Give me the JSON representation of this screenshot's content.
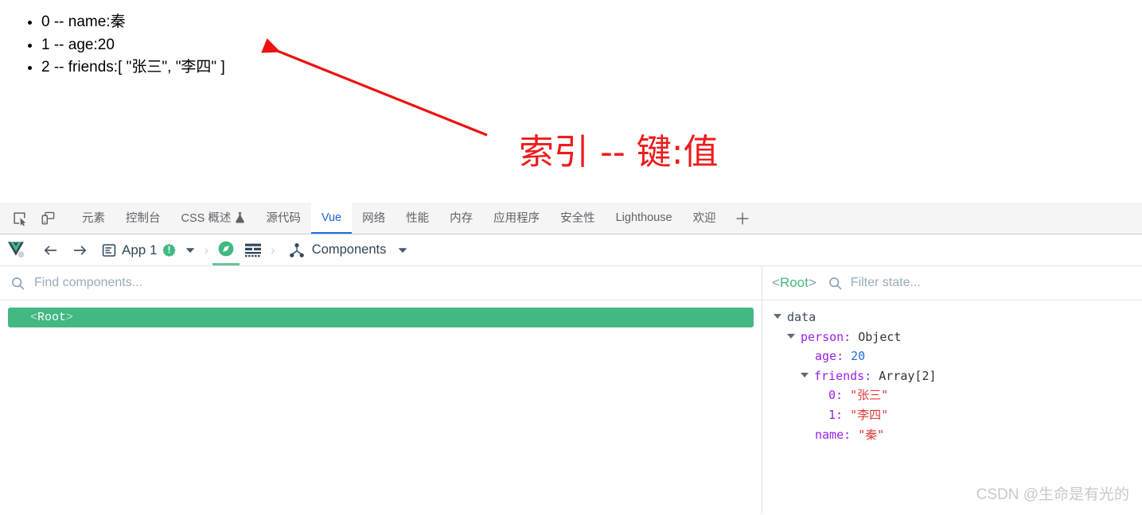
{
  "page": {
    "list_items": [
      "0 -- name:秦",
      "1 -- age:20",
      "2 -- friends:[ \"张三\", \"李四\" ]"
    ],
    "annotation": "索引 -- 键:值",
    "annotation_color": "#ee1c1c"
  },
  "devtools": {
    "left_icons": [
      {
        "name": "inspect-element-icon"
      },
      {
        "name": "device-toolbar-icon"
      }
    ],
    "tabs": [
      {
        "label": "元素",
        "active": false,
        "icon": null
      },
      {
        "label": "控制台",
        "active": false,
        "icon": null
      },
      {
        "label": "CSS 概述",
        "active": false,
        "icon": "flask-icon"
      },
      {
        "label": "源代码",
        "active": false,
        "icon": null
      },
      {
        "label": "Vue",
        "active": true,
        "icon": null
      },
      {
        "label": "网络",
        "active": false,
        "icon": null
      },
      {
        "label": "性能",
        "active": false,
        "icon": null
      },
      {
        "label": "内存",
        "active": false,
        "icon": null
      },
      {
        "label": "应用程序",
        "active": false,
        "icon": null
      },
      {
        "label": "安全性",
        "active": false,
        "icon": null
      },
      {
        "label": "Lighthouse",
        "active": false,
        "icon": null
      },
      {
        "label": "欢迎",
        "active": false,
        "icon": null
      }
    ],
    "add_tab_label": "+"
  },
  "vue_toolbar": {
    "logo": "vue-logo",
    "back_label": "←",
    "forward_label": "→",
    "app_label": "App 1",
    "app_badge": "!",
    "app_dropdown": "▾",
    "crumb_separator": "›",
    "inspector_tab_icon": "compass-icon",
    "timeline_tab_icon": "timeline-icon",
    "panel_label": "Components",
    "panel_dropdown": "▾",
    "accent_green": "#42b883"
  },
  "components_pane": {
    "search_placeholder": "Find components...",
    "search_value": "",
    "tree": [
      {
        "open_bracket": "<",
        "name": "Root",
        "close_bracket": ">",
        "selected": true
      }
    ]
  },
  "state_pane": {
    "root_open_bracket": "<",
    "root_name": "Root",
    "root_close_bracket": ">",
    "filter_placeholder": "Filter state...",
    "filter_value": "",
    "rows": [
      {
        "indent": 0,
        "caret": true,
        "key": "data",
        "key_style": "plain",
        "sep": "",
        "value": "",
        "value_style": "none"
      },
      {
        "indent": 1,
        "caret": true,
        "key": "person",
        "key_style": "prop",
        "sep": ": ",
        "value": "Object",
        "value_style": "type"
      },
      {
        "indent": 2,
        "caret": false,
        "key": "age",
        "key_style": "prop",
        "sep": ": ",
        "value": "20",
        "value_style": "num"
      },
      {
        "indent": 2,
        "caret": true,
        "key": "friends",
        "key_style": "prop",
        "sep": ": ",
        "value": "Array[2]",
        "value_style": "type"
      },
      {
        "indent": 3,
        "caret": false,
        "key": "0",
        "key_style": "prop",
        "sep": ": ",
        "value": "\"张三\"",
        "value_style": "str"
      },
      {
        "indent": 3,
        "caret": false,
        "key": "1",
        "key_style": "prop",
        "sep": ": ",
        "value": "\"李四\"",
        "value_style": "str"
      },
      {
        "indent": 2,
        "caret": false,
        "key": "name",
        "key_style": "prop",
        "sep": ": ",
        "value": "\"秦\"",
        "value_style": "str"
      }
    ]
  },
  "watermark": "CSDN @生命是有光的"
}
